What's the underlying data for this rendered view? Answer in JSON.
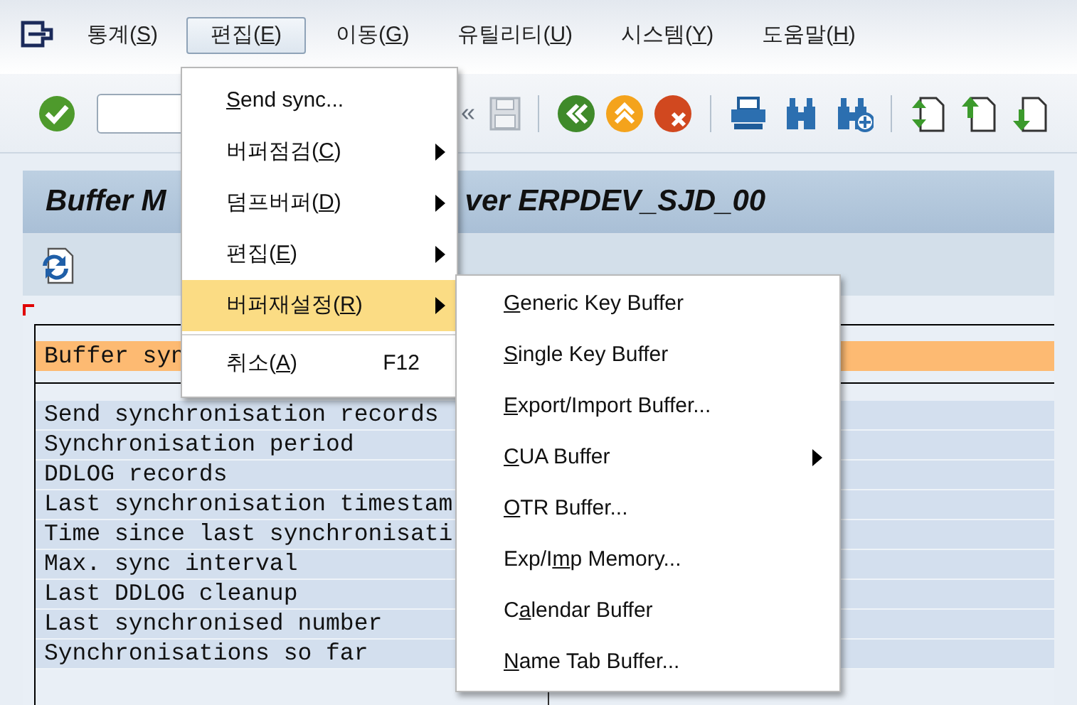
{
  "menubar": [
    {
      "pre": "통계(",
      "key": "S",
      "post": ")",
      "selected": false
    },
    {
      "pre": "편집(",
      "key": "E",
      "post": ")",
      "selected": true
    },
    {
      "pre": "이동(",
      "key": "G",
      "post": ")",
      "selected": false
    },
    {
      "pre": "유틸리티(",
      "key": "U",
      "post": ")",
      "selected": false
    },
    {
      "pre": "시스템(",
      "key": "Y",
      "post": ")",
      "selected": false
    },
    {
      "pre": "도움말(",
      "key": "H",
      "post": ")",
      "selected": false
    }
  ],
  "toolbar": {
    "collapse_glyph": "«"
  },
  "title": {
    "visible_parts": [
      "Buffer M",
      "ver ERPDEV_SJD_00"
    ]
  },
  "list": {
    "header": "Buffer syn",
    "rows": [
      "Send synchronisation records",
      "Synchronisation period",
      "DDLOG records",
      "Last synchronisation timestam",
      "Time since last synchronisati",
      "Max. sync interval",
      "Last DDLOG cleanup",
      "Last synchronised number",
      "Synchronisations so far"
    ]
  },
  "menu": [
    {
      "key": "S",
      "post": "end sync...",
      "submenu": false,
      "selected": false
    },
    {
      "pre": "버퍼점검(",
      "key": "C",
      "post": ")",
      "submenu": true,
      "selected": false
    },
    {
      "pre": "덤프버퍼(",
      "key": "D",
      "post": ")",
      "submenu": true,
      "selected": false
    },
    {
      "pre": "편집(",
      "key": "E",
      "post": ")",
      "submenu": true,
      "selected": false
    },
    {
      "pre": "버퍼재설정(",
      "key": "R",
      "post": ")",
      "submenu": true,
      "selected": true
    },
    {
      "pre": "취소(",
      "key": "A",
      "post": ")",
      "submenu": false,
      "selected": false,
      "shortcut": "F12"
    }
  ],
  "submenu": [
    {
      "key": "G",
      "post": "eneric Key Buffer",
      "submenu": false
    },
    {
      "key": "S",
      "post": "ingle Key Buffer",
      "submenu": false
    },
    {
      "key": "E",
      "post": "xport/Import Buffer...",
      "submenu": false
    },
    {
      "key": "C",
      "post": "UA Buffer",
      "submenu": true
    },
    {
      "key": "O",
      "post": "TR Buffer...",
      "submenu": false
    },
    {
      "pre": "Exp/I",
      "key": "m",
      "post": "p Memory...",
      "submenu": false
    },
    {
      "pre": "C",
      "key": "a",
      "post": "lendar Buffer",
      "submenu": false
    },
    {
      "key": "N",
      "post": "ame Tab Buffer...",
      "submenu": false
    }
  ]
}
